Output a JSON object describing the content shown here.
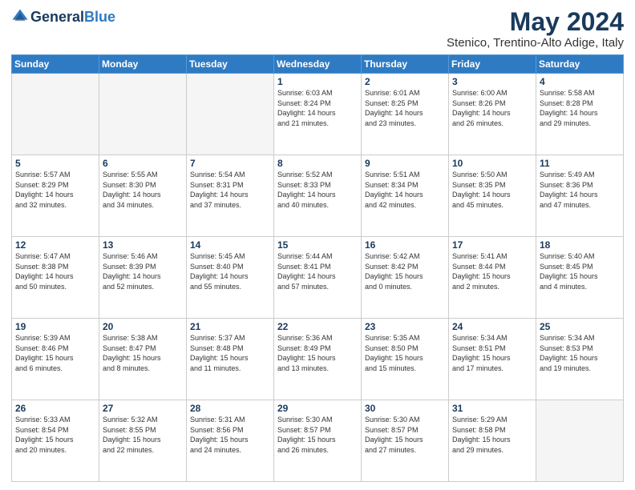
{
  "header": {
    "logo_general": "General",
    "logo_blue": "Blue",
    "month_title": "May 2024",
    "location": "Stenico, Trentino-Alto Adige, Italy"
  },
  "days_of_week": [
    "Sunday",
    "Monday",
    "Tuesday",
    "Wednesday",
    "Thursday",
    "Friday",
    "Saturday"
  ],
  "weeks": [
    [
      {
        "day": "",
        "info": ""
      },
      {
        "day": "",
        "info": ""
      },
      {
        "day": "",
        "info": ""
      },
      {
        "day": "1",
        "info": "Sunrise: 6:03 AM\nSunset: 8:24 PM\nDaylight: 14 hours\nand 21 minutes."
      },
      {
        "day": "2",
        "info": "Sunrise: 6:01 AM\nSunset: 8:25 PM\nDaylight: 14 hours\nand 23 minutes."
      },
      {
        "day": "3",
        "info": "Sunrise: 6:00 AM\nSunset: 8:26 PM\nDaylight: 14 hours\nand 26 minutes."
      },
      {
        "day": "4",
        "info": "Sunrise: 5:58 AM\nSunset: 8:28 PM\nDaylight: 14 hours\nand 29 minutes."
      }
    ],
    [
      {
        "day": "5",
        "info": "Sunrise: 5:57 AM\nSunset: 8:29 PM\nDaylight: 14 hours\nand 32 minutes."
      },
      {
        "day": "6",
        "info": "Sunrise: 5:55 AM\nSunset: 8:30 PM\nDaylight: 14 hours\nand 34 minutes."
      },
      {
        "day": "7",
        "info": "Sunrise: 5:54 AM\nSunset: 8:31 PM\nDaylight: 14 hours\nand 37 minutes."
      },
      {
        "day": "8",
        "info": "Sunrise: 5:52 AM\nSunset: 8:33 PM\nDaylight: 14 hours\nand 40 minutes."
      },
      {
        "day": "9",
        "info": "Sunrise: 5:51 AM\nSunset: 8:34 PM\nDaylight: 14 hours\nand 42 minutes."
      },
      {
        "day": "10",
        "info": "Sunrise: 5:50 AM\nSunset: 8:35 PM\nDaylight: 14 hours\nand 45 minutes."
      },
      {
        "day": "11",
        "info": "Sunrise: 5:49 AM\nSunset: 8:36 PM\nDaylight: 14 hours\nand 47 minutes."
      }
    ],
    [
      {
        "day": "12",
        "info": "Sunrise: 5:47 AM\nSunset: 8:38 PM\nDaylight: 14 hours\nand 50 minutes."
      },
      {
        "day": "13",
        "info": "Sunrise: 5:46 AM\nSunset: 8:39 PM\nDaylight: 14 hours\nand 52 minutes."
      },
      {
        "day": "14",
        "info": "Sunrise: 5:45 AM\nSunset: 8:40 PM\nDaylight: 14 hours\nand 55 minutes."
      },
      {
        "day": "15",
        "info": "Sunrise: 5:44 AM\nSunset: 8:41 PM\nDaylight: 14 hours\nand 57 minutes."
      },
      {
        "day": "16",
        "info": "Sunrise: 5:42 AM\nSunset: 8:42 PM\nDaylight: 15 hours\nand 0 minutes."
      },
      {
        "day": "17",
        "info": "Sunrise: 5:41 AM\nSunset: 8:44 PM\nDaylight: 15 hours\nand 2 minutes."
      },
      {
        "day": "18",
        "info": "Sunrise: 5:40 AM\nSunset: 8:45 PM\nDaylight: 15 hours\nand 4 minutes."
      }
    ],
    [
      {
        "day": "19",
        "info": "Sunrise: 5:39 AM\nSunset: 8:46 PM\nDaylight: 15 hours\nand 6 minutes."
      },
      {
        "day": "20",
        "info": "Sunrise: 5:38 AM\nSunset: 8:47 PM\nDaylight: 15 hours\nand 8 minutes."
      },
      {
        "day": "21",
        "info": "Sunrise: 5:37 AM\nSunset: 8:48 PM\nDaylight: 15 hours\nand 11 minutes."
      },
      {
        "day": "22",
        "info": "Sunrise: 5:36 AM\nSunset: 8:49 PM\nDaylight: 15 hours\nand 13 minutes."
      },
      {
        "day": "23",
        "info": "Sunrise: 5:35 AM\nSunset: 8:50 PM\nDaylight: 15 hours\nand 15 minutes."
      },
      {
        "day": "24",
        "info": "Sunrise: 5:34 AM\nSunset: 8:51 PM\nDaylight: 15 hours\nand 17 minutes."
      },
      {
        "day": "25",
        "info": "Sunrise: 5:34 AM\nSunset: 8:53 PM\nDaylight: 15 hours\nand 19 minutes."
      }
    ],
    [
      {
        "day": "26",
        "info": "Sunrise: 5:33 AM\nSunset: 8:54 PM\nDaylight: 15 hours\nand 20 minutes."
      },
      {
        "day": "27",
        "info": "Sunrise: 5:32 AM\nSunset: 8:55 PM\nDaylight: 15 hours\nand 22 minutes."
      },
      {
        "day": "28",
        "info": "Sunrise: 5:31 AM\nSunset: 8:56 PM\nDaylight: 15 hours\nand 24 minutes."
      },
      {
        "day": "29",
        "info": "Sunrise: 5:30 AM\nSunset: 8:57 PM\nDaylight: 15 hours\nand 26 minutes."
      },
      {
        "day": "30",
        "info": "Sunrise: 5:30 AM\nSunset: 8:57 PM\nDaylight: 15 hours\nand 27 minutes."
      },
      {
        "day": "31",
        "info": "Sunrise: 5:29 AM\nSunset: 8:58 PM\nDaylight: 15 hours\nand 29 minutes."
      },
      {
        "day": "",
        "info": ""
      }
    ]
  ]
}
